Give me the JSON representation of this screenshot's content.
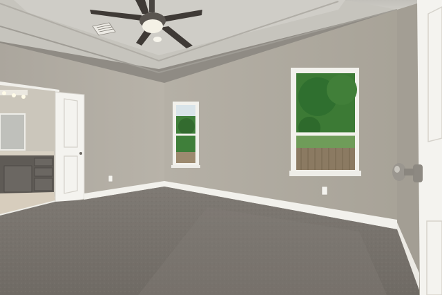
{
  "scene": {
    "kind": "photo",
    "room": "empty bedroom",
    "palette": {
      "wall": "#b6b1a7",
      "wall_shadow": "#a7a298",
      "ceiling": "#c9c7c0",
      "trim": "#f2f1ec",
      "carpet": "#7b7670",
      "door": "#f4f3ef",
      "vanity": "#5f5b56",
      "tile": "#d7cdbd",
      "foliage": "#2f6f2f",
      "fence": "#8b7a62"
    },
    "objects": [
      "ceiling-fan",
      "air-vent",
      "bathroom-doorway",
      "bathroom-vanity",
      "open-interior-door",
      "small-window",
      "large-window",
      "outlet",
      "baseboard",
      "carpet-floor",
      "foreground-door-with-knob"
    ]
  }
}
